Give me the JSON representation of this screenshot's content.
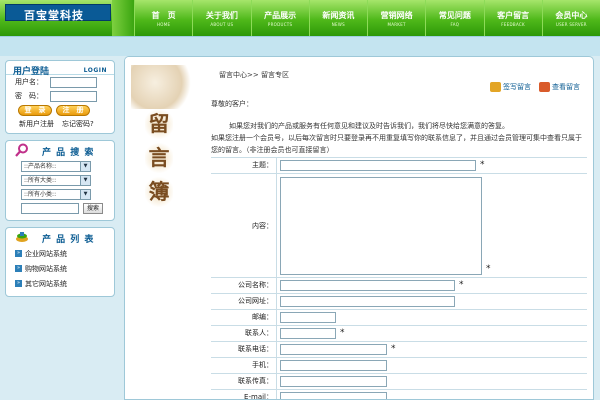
{
  "header": {
    "logo": "百宝堂科技",
    "nav": [
      {
        "cn": "首　页",
        "en": "HOME"
      },
      {
        "cn": "关于我们",
        "en": "ABOUT US"
      },
      {
        "cn": "产品展示",
        "en": "PRODUCTS"
      },
      {
        "cn": "新闻资讯",
        "en": "NEWS"
      },
      {
        "cn": "营销网络",
        "en": "MARKET"
      },
      {
        "cn": "常见问题",
        "en": "FAQ"
      },
      {
        "cn": "客户留言",
        "en": "FEEDBACK"
      },
      {
        "cn": "会员中心",
        "en": "USER SERVER"
      }
    ]
  },
  "login": {
    "title": "用户登陆",
    "title_en": "LOGIN",
    "user_label": "用户名：",
    "password_label": "密　码：",
    "login_button": "登　录",
    "reset_button": "注　册",
    "register_link": "新用户注册",
    "forgot_link": "忘记密码?"
  },
  "search": {
    "title": "产 品 搜 索",
    "selects": [
      "::产品名称::",
      "::所有大类::",
      "::所有小类::"
    ],
    "button": "搜索"
  },
  "products": {
    "title": "产 品 列 表",
    "items": [
      "企业网站系统",
      "购物网站系统",
      "其它网站系统"
    ]
  },
  "deco": [
    "留",
    "言",
    "簿"
  ],
  "main": {
    "breadcrumb": "留言中心>>  留言专区",
    "sign_label": "签写留言",
    "view_label": "查看留言",
    "greeting": "尊敬的客户：",
    "intro1": "如果您对我们的产品或服务有任何意见和建议及时告诉我们，我们将尽快给您满意的答复。",
    "intro2": "如果您注册一个会员号，以后每次留言时只要登录再不用重复填写你的联系信息了，并且通过会员管理可集中查看只属于您的留言。（非注册会员也可直接留言）",
    "fields": {
      "subject": "主题：",
      "content": "内容：",
      "company": "公司名称：",
      "website": "公司网址：",
      "zip": "邮编：",
      "contact": "联系人：",
      "phone": "联系电话：",
      "mobile": "手机：",
      "fax": "联系传真：",
      "email": "E-mail："
    },
    "required_mark": "*"
  },
  "colors": {
    "nav_green": "#4fb81a",
    "logo_blue": "#0a5a96",
    "title_blue": "#0d5d93",
    "deco_brown": "#7a4d21"
  }
}
